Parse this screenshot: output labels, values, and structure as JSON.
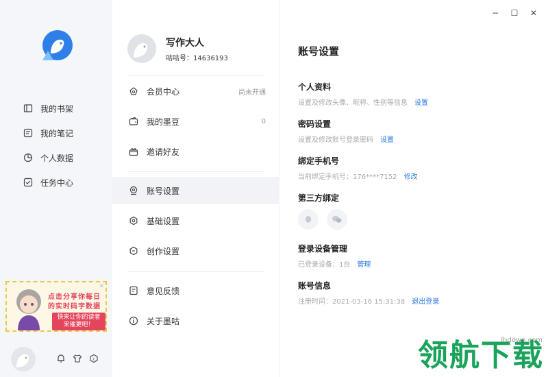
{
  "window": {
    "minimize": "−",
    "maximize": "☐",
    "close": "✕"
  },
  "sidebar": {
    "items": [
      {
        "label": "我的书架",
        "icon": "book-icon"
      },
      {
        "label": "我的笔记",
        "icon": "note-icon"
      },
      {
        "label": "个人数据",
        "icon": "pie-chart-icon"
      },
      {
        "label": "任务中心",
        "icon": "task-icon"
      }
    ],
    "banner": {
      "line1": "点击分享你每日",
      "line2": "的实时码字数据",
      "line3": "快来让你的读者来催更吧！"
    }
  },
  "profile": {
    "name": "写作大人",
    "uid": "咕咕号：14636193"
  },
  "menu": {
    "vip": {
      "label": "会员中心",
      "status": "尚未开通"
    },
    "beans": {
      "label": "我的墨豆",
      "value": "0"
    },
    "invite": {
      "label": "邀请好友"
    },
    "account": {
      "label": "账号设置"
    },
    "basic": {
      "label": "基础设置"
    },
    "creation": {
      "label": "创作设置"
    },
    "feedback": {
      "label": "意见反馈"
    },
    "about": {
      "label": "关于墨咕"
    }
  },
  "content": {
    "title": "账号设置",
    "profile": {
      "title": "个人资料",
      "desc": "设置及修改头像、昵称、性别等信息",
      "action": "设置"
    },
    "password": {
      "title": "密码设置",
      "desc": "设置及修改账号登录密码",
      "action": "设置"
    },
    "phone": {
      "title": "绑定手机号",
      "desc": "当前绑定手机号：176****7152",
      "action": "修改"
    },
    "third": {
      "title": "第三方绑定"
    },
    "devices": {
      "title": "登录设备管理",
      "desc": "已登录设备：1台",
      "action": "管理"
    },
    "info": {
      "title": "账号信息",
      "desc": "注册时间：2021-03-16 15:31:38",
      "action": "退出登录"
    }
  },
  "watermark": {
    "text": "领航下载",
    "url": "lhdown.com"
  },
  "colors": {
    "accent": "#2e7be6",
    "logo": "#2f7fe9",
    "watermark": "#1aa35a"
  }
}
